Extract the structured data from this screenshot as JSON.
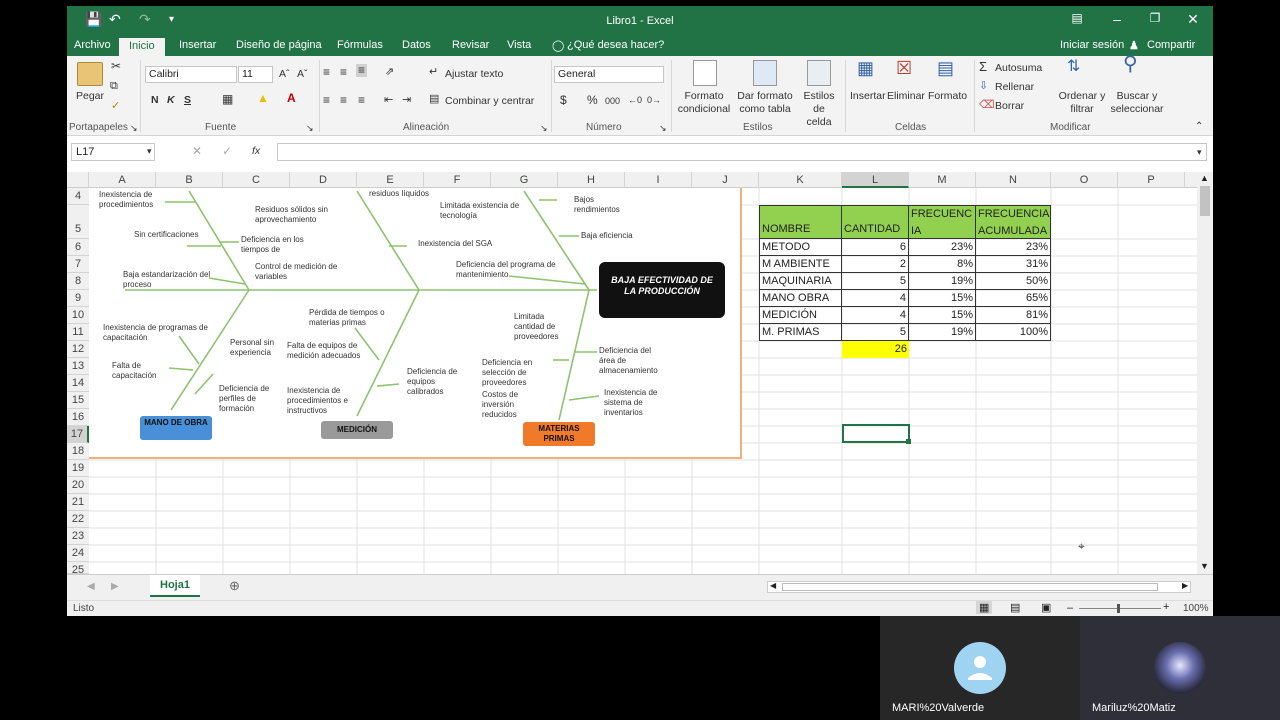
{
  "window": {
    "title": "Libro1 - Excel"
  },
  "tabs": [
    "Archivo",
    "Inicio",
    "Insertar",
    "Diseño de página",
    "Fórmulas",
    "Datos",
    "Revisar",
    "Vista"
  ],
  "tell_me": "¿Qué desea hacer?",
  "account": {
    "signin": "Iniciar sesión",
    "share": "Compartir"
  },
  "ribbon": {
    "clipboard": {
      "paste": "Pegar",
      "group": "Portapapeles"
    },
    "font": {
      "name": "Calibri",
      "size": "11",
      "bold": "N",
      "italic": "K",
      "underline": "S",
      "group": "Fuente"
    },
    "alignment": {
      "wrap": "Ajustar texto",
      "merge": "Combinar y centrar",
      "group": "Alineación"
    },
    "number": {
      "format": "General",
      "currency": "$",
      "percent": "%",
      "thousands": "000",
      "group": "Número"
    },
    "styles": {
      "cond": [
        "Formato",
        "condicional"
      ],
      "table": [
        "Dar formato",
        "como tabla"
      ],
      "cell": [
        "Estilos de",
        "celda"
      ],
      "group": "Estilos"
    },
    "cells": {
      "insert": "Insertar",
      "delete": "Eliminar",
      "format": "Formato",
      "group": "Celdas"
    },
    "editing": {
      "autosum": "Autosuma",
      "fill": "Rellenar",
      "clear": "Borrar",
      "sort": [
        "Ordenar y",
        "filtrar"
      ],
      "find": [
        "Buscar y",
        "seleccionar"
      ],
      "group": "Modificar"
    }
  },
  "formula_bar": {
    "name_box": "L17",
    "fx": "fx",
    "value": ""
  },
  "columns": [
    "A",
    "B",
    "C",
    "D",
    "E",
    "F",
    "G",
    "H",
    "I",
    "J",
    "K",
    "L",
    "M",
    "N",
    "O",
    "P"
  ],
  "rows": [
    "4",
    "5",
    "6",
    "7",
    "8",
    "9",
    "10",
    "11",
    "12",
    "13",
    "14",
    "15",
    "16",
    "17",
    "18",
    "19",
    "20",
    "21",
    "22",
    "23",
    "24",
    "25"
  ],
  "fishbone": {
    "effect": "BAJA EFECTIVIDAD DE LA PRODUCCIÓN",
    "labels": [
      "Inexistencia de procedimientos",
      "Sin certificaciones",
      "Deficiencia en los tiempos de",
      "Baja estandarización del proceso",
      "Control de medición de variables",
      "Residuos sólidos sin aprovechamiento",
      "residuos líquidos",
      "Inexistencia del SGA",
      "Limitada existencia de tecnología",
      "Bajos rendimientos",
      "Baja eficiencia",
      "Deficiencia del programa de mantenimiento",
      "Inexistencia de programas de capacitación",
      "Personal sin experiencia",
      "Falta de capacitación",
      "Deficiencia de perfiles de formación",
      "Pérdida de tiempos o materias primas",
      "Falta de equipos de medición adecuados",
      "Deficiencia de equipos calibrados",
      "Inexistencia de procedimientos e instructivos",
      "Limitada cantidad de proveedores",
      "Deficiencia del área de almacenamiento",
      "Deficiencia en selección de proveedores",
      "Costos de inversión reducidos",
      "Inexistencia de sistema de inventarios"
    ],
    "categories": [
      "MANO DE OBRA",
      "MEDICIÓN",
      "MATERIAS PRIMAS"
    ]
  },
  "table": {
    "headers": [
      "NOMBRE",
      "CANTIDAD",
      "FRECUENCIA",
      "FRECUENCIA ACUMULADA"
    ],
    "rows": [
      [
        "METODO",
        "6",
        "23%",
        "23%"
      ],
      [
        "M AMBIENTE",
        "2",
        "8%",
        "31%"
      ],
      [
        "MAQUINARIA",
        "5",
        "19%",
        "50%"
      ],
      [
        "MANO OBRA",
        "4",
        "15%",
        "65%"
      ],
      [
        "MEDICIÓN",
        "4",
        "15%",
        "81%"
      ],
      [
        "M. PRIMAS",
        "5",
        "19%",
        "100%"
      ]
    ],
    "total": "26"
  },
  "sheet": {
    "name": "Hoja1"
  },
  "status": {
    "ready": "Listo",
    "zoom": "100%"
  },
  "participants": [
    "MARI%20Valverde",
    "Mariluz%20Matiz"
  ],
  "colors": {
    "excel_green": "#217346",
    "table_header": "#92d050",
    "total_cell": "#ffff00"
  }
}
